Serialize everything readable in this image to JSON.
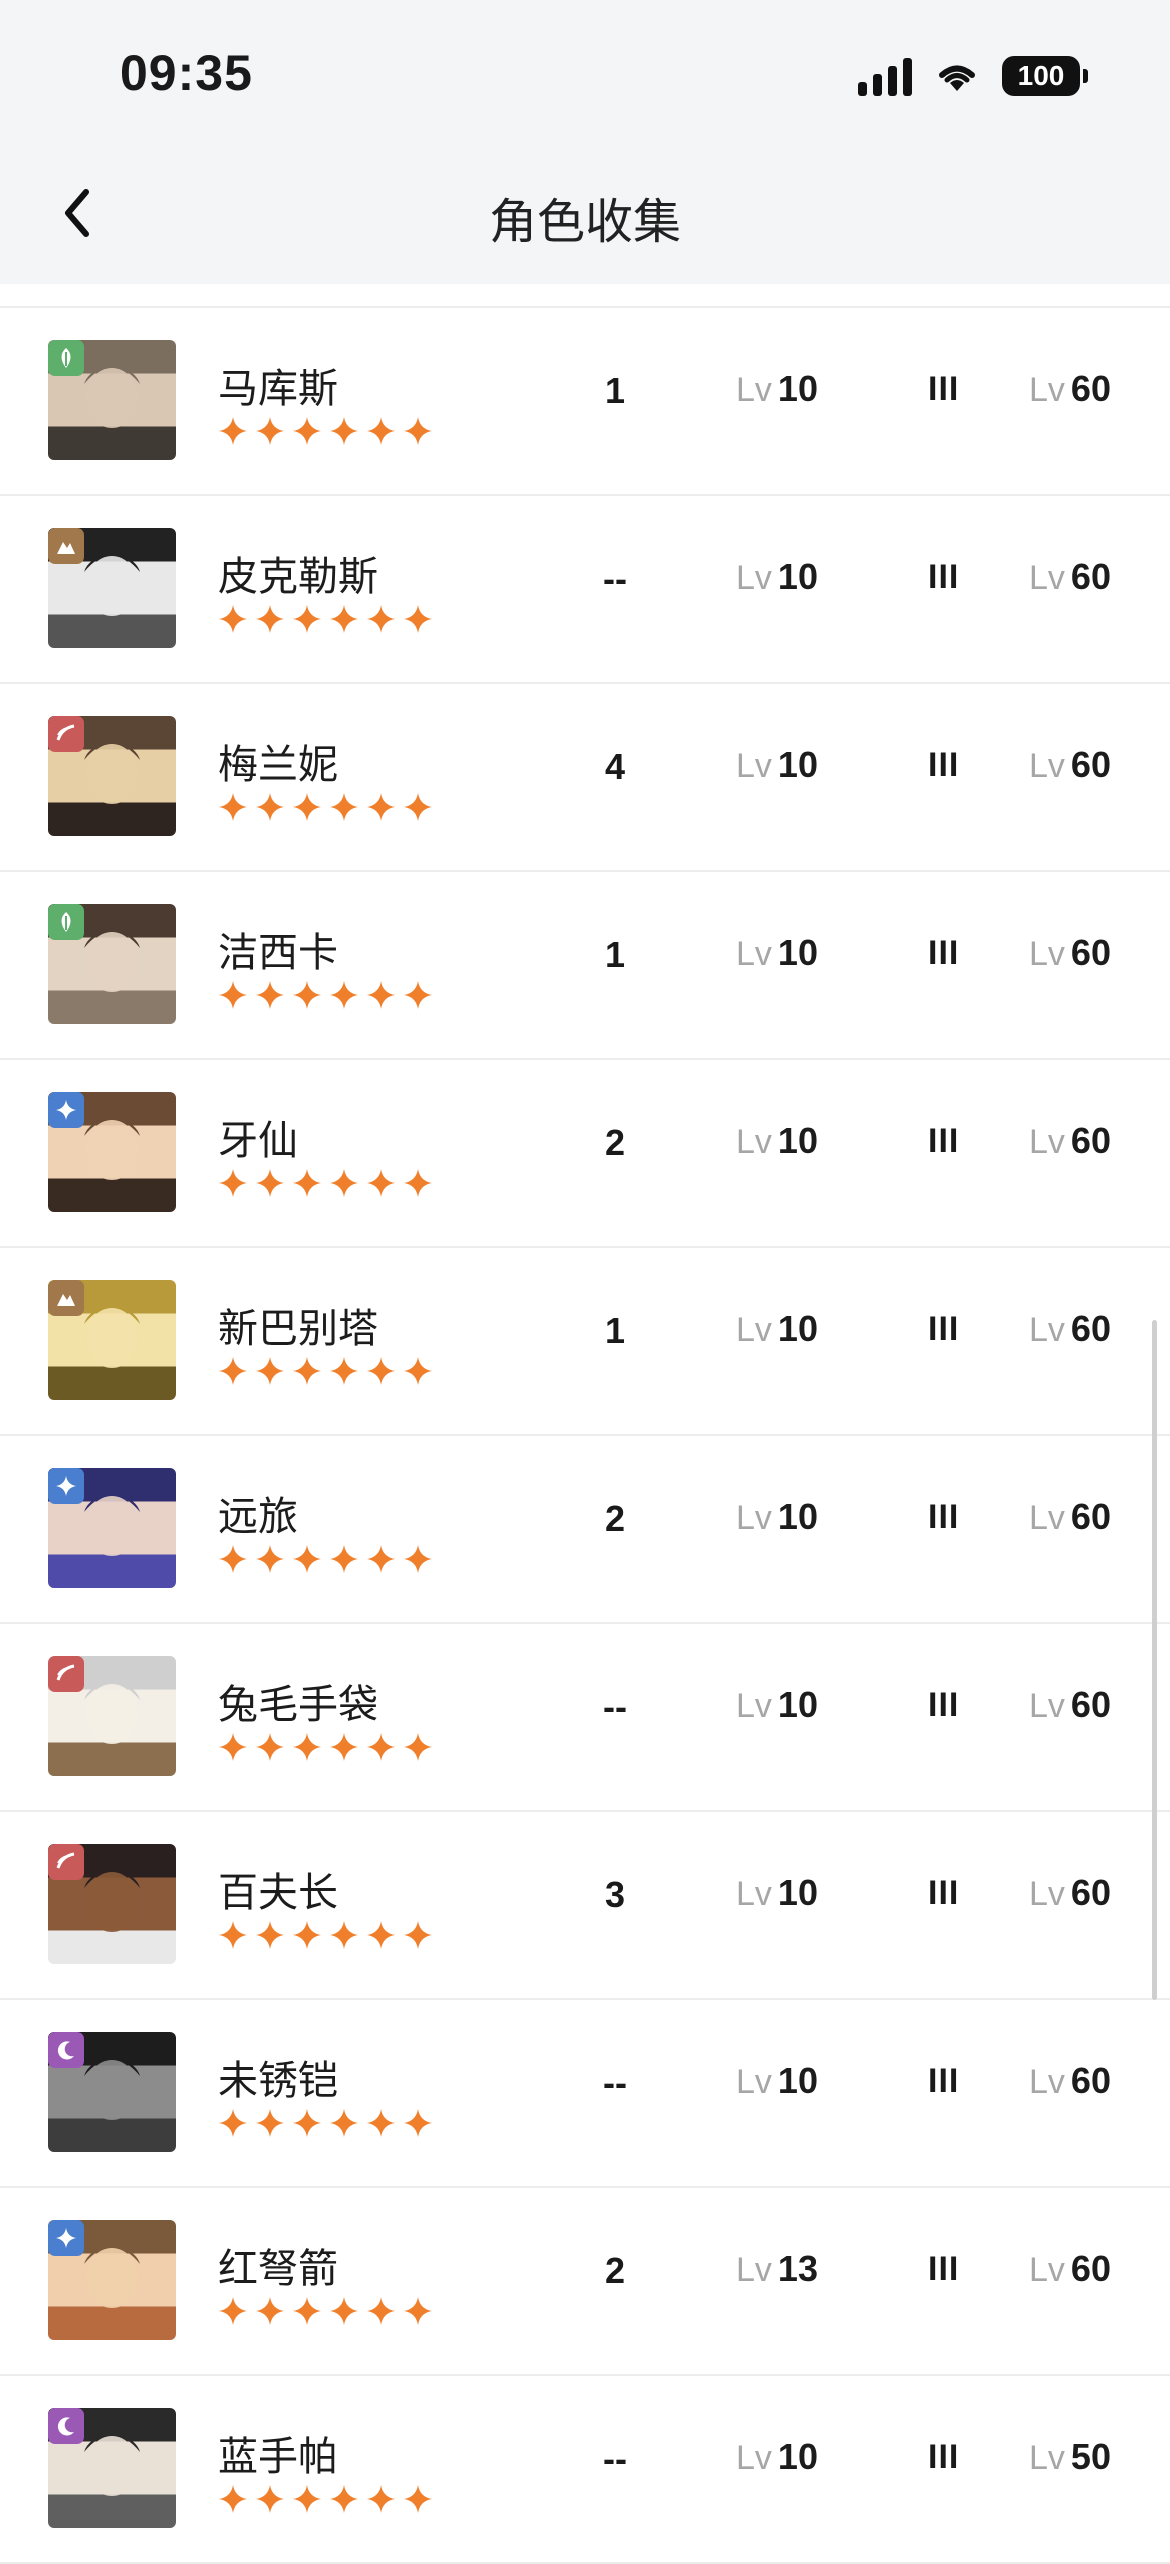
{
  "status_bar": {
    "time": "09:35",
    "battery": "100"
  },
  "header": {
    "title": "角色收集"
  },
  "colors": {
    "accent_star": "#f07f2c",
    "divider": "#ececec"
  },
  "characters": [
    {
      "name": "马库斯",
      "count": "1",
      "level": "10",
      "rank": "III",
      "max_level": "60",
      "element": "leaf",
      "element_color": "#5eae6c",
      "stars": 6
    },
    {
      "name": "皮克勒斯",
      "count": "--",
      "level": "10",
      "rank": "III",
      "max_level": "60",
      "element": "rock",
      "element_color": "#a0784b",
      "stars": 6
    },
    {
      "name": "梅兰妮",
      "count": "4",
      "level": "10",
      "rank": "III",
      "max_level": "60",
      "element": "beast",
      "element_color": "#c85a5a",
      "stars": 6
    },
    {
      "name": "洁西卡",
      "count": "1",
      "level": "10",
      "rank": "III",
      "max_level": "60",
      "element": "leaf",
      "element_color": "#5eae6c",
      "stars": 6
    },
    {
      "name": "牙仙",
      "count": "2",
      "level": "10",
      "rank": "III",
      "max_level": "60",
      "element": "star",
      "element_color": "#4a7fd0",
      "stars": 6
    },
    {
      "name": "新巴别塔",
      "count": "1",
      "level": "10",
      "rank": "III",
      "max_level": "60",
      "element": "rock",
      "element_color": "#a0784b",
      "stars": 6
    },
    {
      "name": "远旅",
      "count": "2",
      "level": "10",
      "rank": "III",
      "max_level": "60",
      "element": "star",
      "element_color": "#4a7fd0",
      "stars": 6
    },
    {
      "name": "兔毛手袋",
      "count": "--",
      "level": "10",
      "rank": "III",
      "max_level": "60",
      "element": "beast",
      "element_color": "#c85a5a",
      "stars": 6
    },
    {
      "name": "百夫长",
      "count": "3",
      "level": "10",
      "rank": "III",
      "max_level": "60",
      "element": "beast",
      "element_color": "#c85a5a",
      "stars": 6
    },
    {
      "name": "未锈铠",
      "count": "--",
      "level": "10",
      "rank": "III",
      "max_level": "60",
      "element": "moon",
      "element_color": "#9b59b6",
      "stars": 6
    },
    {
      "name": "红弩箭",
      "count": "2",
      "level": "13",
      "rank": "III",
      "max_level": "60",
      "element": "star",
      "element_color": "#4a7fd0",
      "stars": 6
    },
    {
      "name": "蓝手帕",
      "count": "--",
      "level": "10",
      "rank": "III",
      "max_level": "50",
      "element": "moon",
      "element_color": "#9b59b6",
      "stars": 6
    }
  ],
  "labels": {
    "lv_prefix": "Lv"
  }
}
